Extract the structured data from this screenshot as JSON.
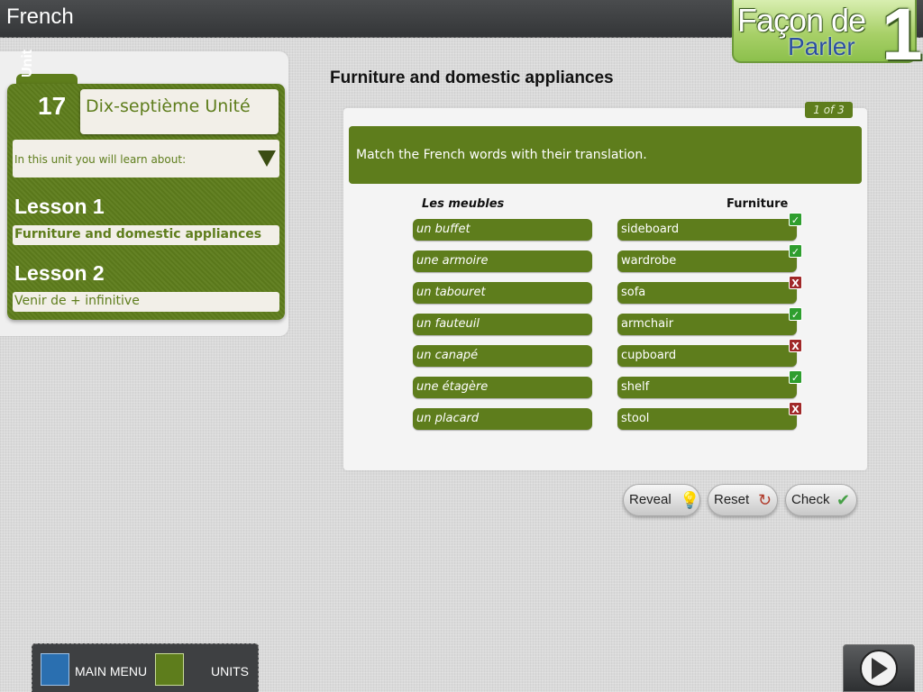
{
  "header": {
    "app_title": "French"
  },
  "logo": {
    "line1": "Façon de",
    "line2": "Parler",
    "number": "1"
  },
  "unit": {
    "label": "Unit",
    "number": "17",
    "title": "Dix-septième Unité",
    "learn_about": "In this unit you will learn about:",
    "lessons": [
      {
        "heading": "Lesson 1",
        "title": "Furniture and domestic appliances"
      },
      {
        "heading": "Lesson 2",
        "title": "Venir de + infinitive"
      }
    ]
  },
  "exercise": {
    "heading": "Furniture and domestic appliances",
    "page_indicator": "1 of 3",
    "instruction": "Match the French words with their translation.",
    "left_header": "Les meubles",
    "right_header": "Furniture",
    "rows": [
      {
        "french": "un buffet",
        "english": "sideboard",
        "result": "✓"
      },
      {
        "french": "une armoire",
        "english": "wardrobe",
        "result": "✓"
      },
      {
        "french": "un tabouret",
        "english": "sofa",
        "result": "X"
      },
      {
        "french": "un fauteuil",
        "english": "armchair",
        "result": "✓"
      },
      {
        "french": "un canapé",
        "english": "cupboard",
        "result": "X"
      },
      {
        "french": "une étagère",
        "english": "shelf",
        "result": "✓"
      },
      {
        "french": "un placard",
        "english": "stool",
        "result": "X"
      }
    ]
  },
  "actions": {
    "reveal": "Reveal",
    "reset": "Reset",
    "check": "Check"
  },
  "nav": {
    "main_menu": "MAIN MENU",
    "units": "UNITS"
  },
  "colors": {
    "accent_green": "#5e7d1c",
    "correct": "#2e9e2e",
    "incorrect": "#a02828"
  }
}
